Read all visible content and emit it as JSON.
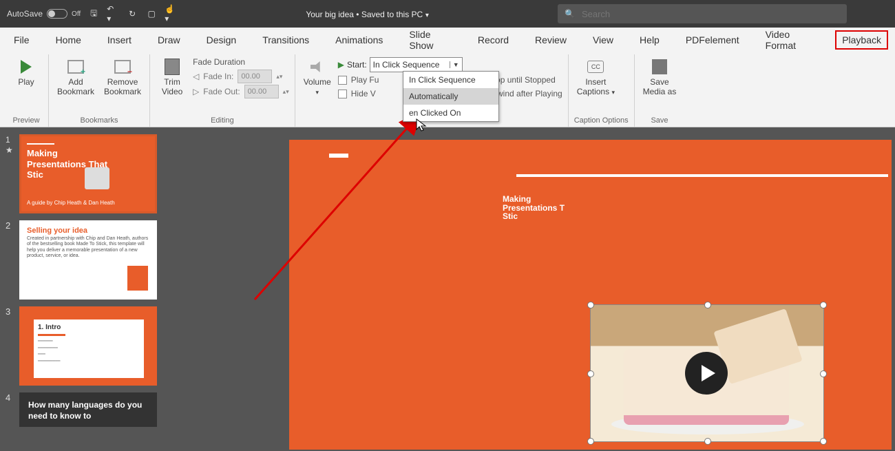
{
  "titlebar": {
    "autosave_label": "AutoSave",
    "autosave_state": "Off",
    "doc_title": "Your big idea • Saved to this PC",
    "search_placeholder": "Search"
  },
  "tabs": {
    "file": "File",
    "home": "Home",
    "insert": "Insert",
    "draw": "Draw",
    "design": "Design",
    "transitions": "Transitions",
    "animations": "Animations",
    "slideshow": "Slide Show",
    "record": "Record",
    "review": "Review",
    "view": "View",
    "help": "Help",
    "pdfelement": "PDFelement",
    "videoformat": "Video Format",
    "playback": "Playback"
  },
  "ribbon": {
    "preview": {
      "play": "Play",
      "group": "Preview"
    },
    "bookmarks": {
      "add": "Add\nBookmark",
      "remove": "Remove\nBookmark",
      "group": "Bookmarks"
    },
    "editing": {
      "trim": "Trim\nVideo",
      "fade_duration": "Fade Duration",
      "fade_in": "Fade In:",
      "fade_out": "Fade Out:",
      "fade_in_val": "00.00",
      "fade_out_val": "00.00",
      "group": "Editing"
    },
    "video_options": {
      "volume": "Volume",
      "start_label": "Start:",
      "start_value": "In Click Sequence",
      "play_full": "Play Fu",
      "hide": "Hide V",
      "loop": "Loop until Stopped",
      "rewind": "Rewind after Playing",
      "dropdown": {
        "opt1": "In Click Sequence",
        "opt2": "Automatically",
        "opt3": "en Clicked On"
      }
    },
    "caption": {
      "insert": "Insert\nCaptions",
      "group": "Caption Options"
    },
    "save": {
      "save_as": "Save\nMedia as",
      "group": "Save"
    }
  },
  "thumbs": {
    "n1": "1",
    "n2": "2",
    "n3": "3",
    "n4": "4",
    "t1_title": "Making\nPresentations That\nStic",
    "t1_sub": "A guide by Chip Heath & Dan Heath",
    "t2_title": "Selling your idea",
    "t2_body": "Created in partnership with Chip and Dan Heath, authors of the bestselling book Made To Stick, this template will help you deliver a memorable presentation of a new product, service, or idea.",
    "t3_title": "1. Intro",
    "t4_title": "How many languages do you need to know to"
  },
  "canvas": {
    "title_l1": "Making",
    "title_l2": "Presentations T",
    "title_l3": "Stic"
  }
}
